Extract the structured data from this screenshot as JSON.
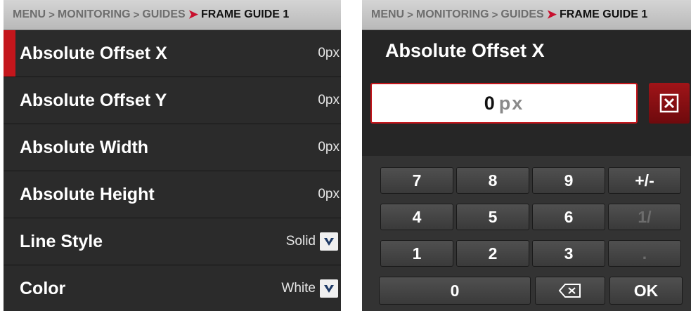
{
  "left": {
    "breadcrumb": [
      "MENU",
      "MONITORING",
      "GUIDES",
      "FRAME GUIDE 1"
    ],
    "rows": [
      {
        "label": "Absolute Offset X",
        "value": "0px"
      },
      {
        "label": "Absolute Offset Y",
        "value": "0px"
      },
      {
        "label": "Absolute Width",
        "value": "0px"
      },
      {
        "label": "Absolute Height",
        "value": "0px"
      },
      {
        "label": "Line Style",
        "value": "Solid"
      },
      {
        "label": "Color",
        "value": "White"
      }
    ]
  },
  "right": {
    "breadcrumb": [
      "MENU",
      "MONITORING",
      "GUIDES",
      "FRAME GUIDE 1"
    ],
    "title": "Absolute Offset X",
    "input": {
      "value": "0",
      "unit": "px"
    },
    "keys": {
      "k7": "7",
      "k8": "8",
      "k9": "9",
      "plusminus": "+/-",
      "k4": "4",
      "k5": "5",
      "k6": "6",
      "fraction": "1/",
      "k1": "1",
      "k2": "2",
      "k3": "3",
      "decimal": ".",
      "k0": "0",
      "ok": "OK"
    }
  },
  "icons": {
    "breadcrumb_separator": "chevron-right-icon",
    "current_separator": "red-arrow-icon",
    "dropdown": "chevron-down-icon",
    "clear": "clear-x-icon",
    "backspace": "backspace-icon"
  },
  "colors": {
    "accent_red": "#c4161c",
    "panel_bg": "#262626",
    "breadcrumb_bg": "#c8c8c8"
  }
}
